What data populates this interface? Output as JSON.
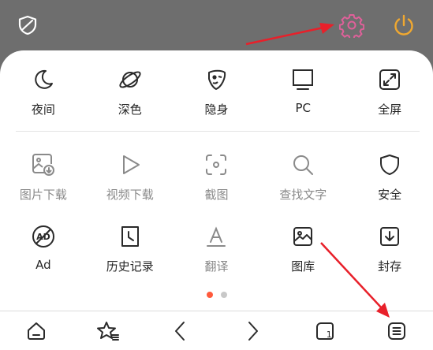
{
  "colors": {
    "topbar_bg": "#6e6e6e",
    "gear_accent": "#e0609a",
    "power_accent": "#f0a830",
    "annotation_arrow": "#e8202a",
    "page_dot_active": "#ff5a3c",
    "page_dot_inactive": "#c8c8c8"
  },
  "topbar": {
    "icons": [
      "shield-check-icon",
      "gear-icon",
      "power-icon"
    ]
  },
  "menu": {
    "row1": [
      {
        "icon": "moon-icon",
        "label": "夜间"
      },
      {
        "icon": "planet-icon",
        "label": "深色"
      },
      {
        "icon": "incognito-mask-icon",
        "label": "隐身"
      },
      {
        "icon": "monitor-icon",
        "label": "PC"
      },
      {
        "icon": "fullscreen-icon",
        "label": "全屏"
      }
    ],
    "row2": [
      {
        "icon": "image-download-icon",
        "label": "图片下载"
      },
      {
        "icon": "play-icon",
        "label": "视频下载"
      },
      {
        "icon": "screenshot-icon",
        "label": "截图"
      },
      {
        "icon": "search-icon",
        "label": "查找文字"
      },
      {
        "icon": "shield-icon",
        "label": "安全"
      }
    ],
    "row3": [
      {
        "icon": "ad-block-icon",
        "label": "Ad"
      },
      {
        "icon": "history-icon",
        "label": "历史记录"
      },
      {
        "icon": "translate-icon",
        "label": "翻译"
      },
      {
        "icon": "gallery-icon",
        "label": "图库"
      },
      {
        "icon": "archive-download-icon",
        "label": "封存"
      }
    ]
  },
  "pager": {
    "pages": 2,
    "current": 1
  },
  "bottom_nav": {
    "items": [
      "home-icon",
      "bookmark-star-icon",
      "back-icon",
      "forward-icon",
      "tabs-icon",
      "menu-icon"
    ],
    "tab_count": "1"
  }
}
